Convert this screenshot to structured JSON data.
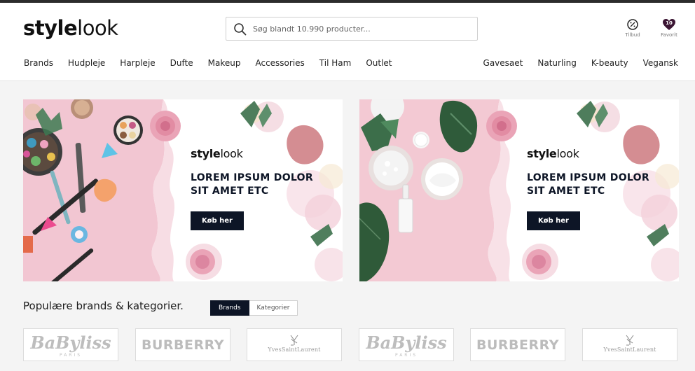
{
  "header": {
    "logo_bold": "style",
    "logo_light": "look",
    "search_placeholder": "Søg blandt 10.990 producter...",
    "offers_label": "Tilbud",
    "favorites_label": "Favorit",
    "favorites_count": "10",
    "icons": [
      "search-icon",
      "offers-icon",
      "favorites-heart-icon"
    ]
  },
  "nav": {
    "left": [
      "Brands",
      "Hudpleje",
      "Harpleje",
      "Dufte",
      "Makeup",
      "Accessories",
      "Til Ham",
      "Outlet"
    ],
    "right": [
      "Gavesaet",
      "Naturling",
      "K-beauty",
      "Vegansk"
    ]
  },
  "banners": [
    {
      "logo_bold": "style",
      "logo_light": "look",
      "heading": "LOREM IPSUM DOLOR SIT AMET ETC",
      "button": "Køb her"
    },
    {
      "logo_bold": "style",
      "logo_light": "look",
      "heading": "LOREM IPSUM DOLOR SIT AMET ETC",
      "button": "Køb her"
    }
  ],
  "popular": {
    "title": "Populære brands & kategorier.",
    "tab_active": "Brands",
    "tab_inactive": "Kategorier"
  },
  "brands": [
    {
      "name": "BaByliss",
      "sub": "PARIS"
    },
    {
      "name": "BURBERRY"
    },
    {
      "name": "YvesSaintLaurent"
    },
    {
      "name": "BaByliss",
      "sub": "PARIS"
    },
    {
      "name": "BURBERRY"
    },
    {
      "name": "YvesSaintLaurent"
    }
  ],
  "colors": {
    "accent": "#0d1526",
    "banner_pink": "#f2c6d2",
    "favorites_badge": "#3b1533"
  }
}
